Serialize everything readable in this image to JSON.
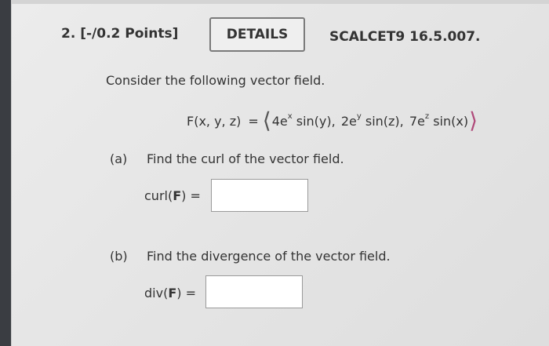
{
  "question": {
    "number": "2.",
    "points": "[-/0.2 Points]",
    "details_label": "DETAILS",
    "reference": "SCALCET9 16.5.007."
  },
  "prompt": "Consider the following vector field.",
  "formula": {
    "lhs": "F(x, y, z)",
    "equals": "=",
    "left_bracket": "⟨",
    "right_bracket": "⟩",
    "components": [
      {
        "base": "4e",
        "exp": "x",
        "tail": " sin(y),"
      },
      {
        "base": "2e",
        "exp": "y",
        "tail": " sin(z),"
      },
      {
        "base": "7e",
        "exp": "z",
        "tail": " sin(x)"
      }
    ]
  },
  "parts": [
    {
      "letter": "(a)",
      "text": "Find the curl of the vector field.",
      "answer_fn": "curl(",
      "answer_arg": "F",
      "answer_close": ")",
      "answer_eq": "=",
      "answer_value": ""
    },
    {
      "letter": "(b)",
      "text": "Find the divergence of the vector field.",
      "answer_fn": "div(",
      "answer_arg": "F",
      "answer_close": ")",
      "answer_eq": "=",
      "answer_value": ""
    }
  ]
}
